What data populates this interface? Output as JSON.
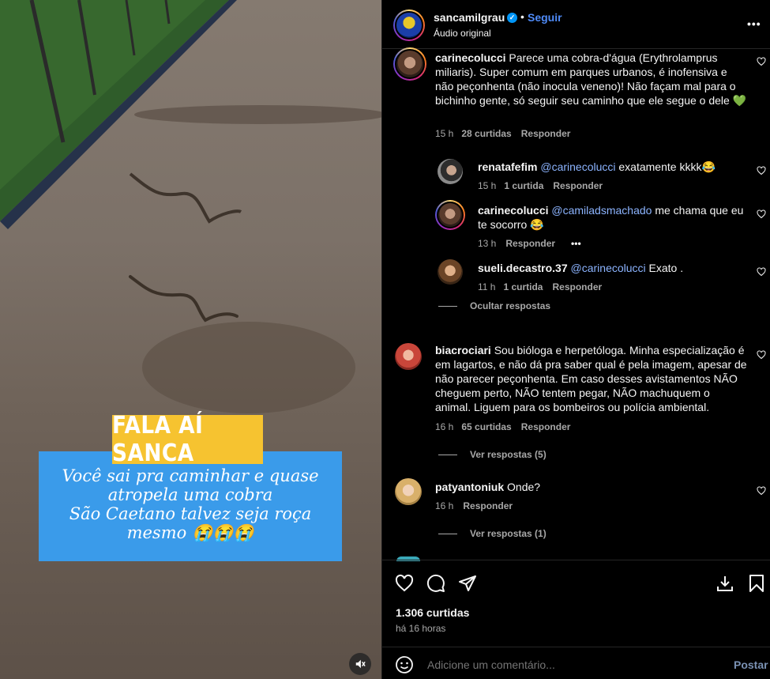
{
  "media": {
    "overlay_title": "FALA AÍ SANCA",
    "overlay_lines": [
      "Você sai pra caminhar e quase",
      "atropela uma cobra",
      "São Caetano talvez seja roça",
      "mesmo 😭😭😭"
    ]
  },
  "header": {
    "username": "sancamilgrau",
    "follow_label": "Seguir",
    "audio_label": "Áudio original",
    "more_label": "•••"
  },
  "comments": [
    {
      "username": "carinecolucci",
      "text": "Parece uma cobra-d'água (Erythrolamprus miliaris). Super comum em parques urbanos, é inofensiva e não peçonhenta (não inocula veneno)! Não façam mal para o bichinho gente, só seguir seu caminho que ele segue o dele 💚",
      "time": "15 h",
      "likes": "28 curtidas",
      "reply": "Responder"
    },
    {
      "username": "renatafefim",
      "mention": "@carinecolucci",
      "text": "exatamente kkkk😂",
      "time": "15 h",
      "likes": "1 curtida",
      "reply": "Responder"
    },
    {
      "username": "carinecolucci",
      "mention": "@camiladsmachado",
      "text": "me chama que eu te socorro 😂",
      "time": "13 h",
      "reply": "Responder",
      "more": "•••"
    },
    {
      "username": "sueli.decastro.37",
      "mention": "@carinecolucci",
      "text": "Exato .",
      "time": "11 h",
      "likes": "1 curtida",
      "reply": "Responder"
    },
    {
      "username": "biacrociari",
      "text": "Sou bióloga e herpetóloga. Minha especialização é em lagartos, e não dá pra saber qual é pela imagem, apesar de não parecer peçonhenta. Em caso desses avistamentos NÃO cheguem perto, NÃO tentem pegar, NÃO machuquem o animal. Liguem para os bombeiros ou polícia ambiental.",
      "time": "16 h",
      "likes": "65 curtidas",
      "reply": "Responder"
    },
    {
      "username": "patyantoniuk",
      "text": "Onde?",
      "time": "16 h",
      "reply": "Responder"
    }
  ],
  "toggles": {
    "hide_replies": "Ocultar respostas",
    "view_replies_5": "Ver respostas (5)",
    "view_replies_1": "Ver respostas (1)"
  },
  "footer": {
    "likes_count": "1.306 curtidas",
    "time_ago": "há 16 horas",
    "comment_placeholder": "Adicione um comentário...",
    "post_label": "Postar"
  },
  "colors": {
    "accent": "#0095f6",
    "follow": "#4f8bf8",
    "overlay_yellow": "#f6c330",
    "overlay_blue": "#3a9bea"
  }
}
